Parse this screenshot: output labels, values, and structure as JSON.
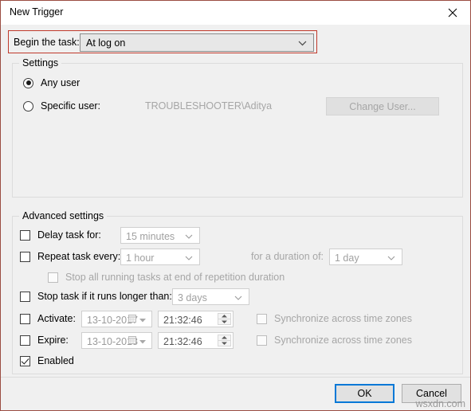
{
  "window": {
    "title": "New Trigger",
    "close_icon": "close-icon"
  },
  "begin": {
    "label": "Begin the task:",
    "value": "At log on",
    "highlight_color": "#c0392b"
  },
  "settings": {
    "legend": "Settings",
    "any_user": {
      "label": "Any user",
      "checked": true
    },
    "specific_user": {
      "label": "Specific user:",
      "checked": false
    },
    "user_name": "TROUBLESHOOTER\\Aditya",
    "change_user_button": "Change User..."
  },
  "advanced": {
    "legend": "Advanced settings",
    "delay_task": {
      "label": "Delay task for:",
      "checked": false,
      "value": "15 minutes"
    },
    "repeat_task": {
      "label": "Repeat task every:",
      "checked": false,
      "value": "1 hour"
    },
    "duration_label": "for a duration of:",
    "duration_value": "1 day",
    "stop_all_running": {
      "label": "Stop all running tasks at end of repetition duration",
      "checked": false
    },
    "stop_task_longer": {
      "label": "Stop task if it runs longer than:",
      "checked": false,
      "value": "3 days"
    },
    "activate": {
      "label": "Activate:",
      "checked": false,
      "date": "13-10-2017",
      "time": "21:32:46",
      "sync_label": "Synchronize across time zones",
      "sync_checked": false
    },
    "expire": {
      "label": "Expire:",
      "checked": false,
      "date": "13-10-2018",
      "time": "21:32:46",
      "sync_label": "Synchronize across time zones",
      "sync_checked": false
    },
    "enabled": {
      "label": "Enabled",
      "checked": true
    }
  },
  "footer": {
    "ok": "OK",
    "cancel": "Cancel",
    "accent_color": "#0078d7"
  },
  "watermark": "wsxdn.com"
}
